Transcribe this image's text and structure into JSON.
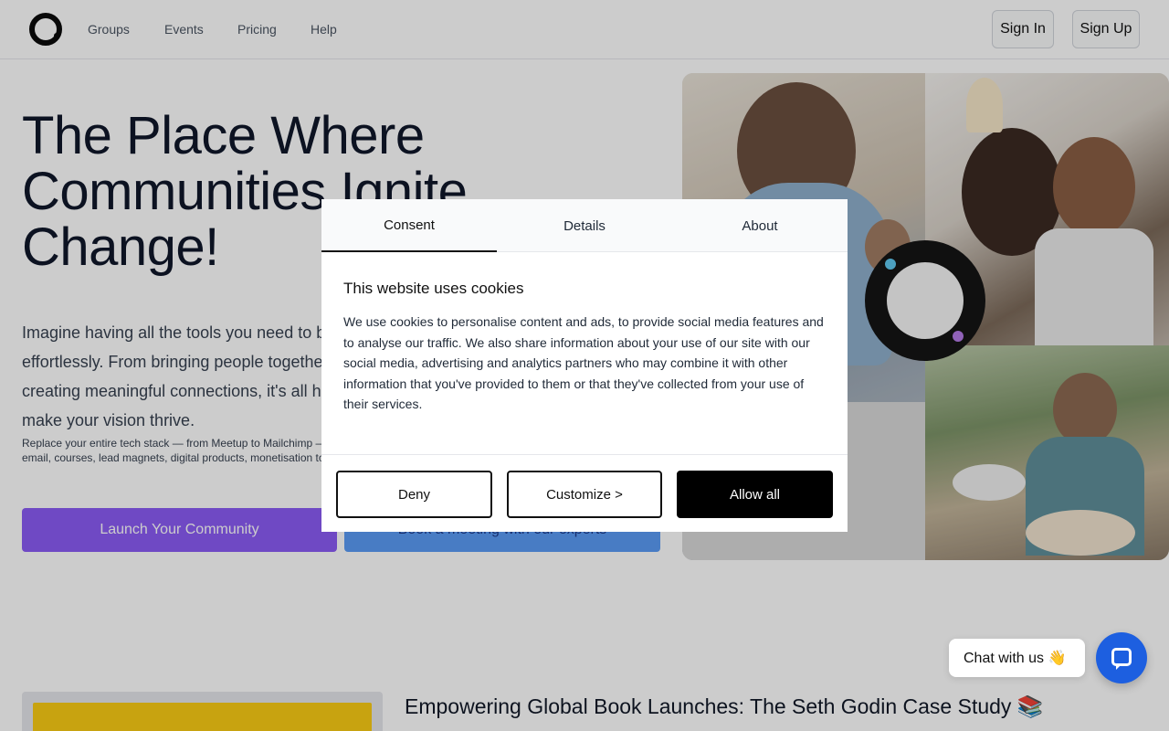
{
  "header": {
    "logo_icon": "ring-logo-icon",
    "nav": [
      "Groups",
      "Events",
      "Pricing",
      "Help"
    ],
    "sign_in": "Sign In",
    "sign_up": "Sign Up"
  },
  "hero": {
    "title_line1": "The Place Where",
    "title_line2": "Communities Ignite",
    "title_line3": "Change!",
    "desc_line1": "Imagine having all the tools you need to build and manage your community",
    "desc_line2": "effortlessly. From bringing people together to launching events and",
    "desc_line3": "creating meaningful connections, it's all here in one platform to help",
    "desc_line4": "make your vision thrive.",
    "small_line1": "Replace your entire tech stack — from Meetup to Mailchimp — with one platform for events,",
    "small_line2": "email, courses, lead magnets, digital products, monetisation tools and more.",
    "cta_primary": "Launch Your Community",
    "cta_secondary": "Book a meeting with our experts"
  },
  "case_study": {
    "title": "Empowering Global Book Launches: The Seth Godin Case Study 📚"
  },
  "cookie_dialog": {
    "tabs": [
      "Consent",
      "Details",
      "About"
    ],
    "active_tab": "Consent",
    "title": "This website uses cookies",
    "text": "We use cookies to personalise content and ads, to provide social media features and to analyse our traffic. We also share information about your use of our site with our social media, advertising and analytics partners who may combine it with other information that you've provided to them or that they've collected from your use of their services.",
    "deny": "Deny",
    "customize": "Customize >",
    "allow_all": "Allow all"
  },
  "chat": {
    "label": "Chat with us 👋",
    "icon": "chat-bubble-icon"
  },
  "colors": {
    "cta_primary": "#8b5cf6",
    "cta_secondary": "#5b9cf6",
    "chat_button": "#1d5fe0",
    "overlay": "rgba(0,0,0,0.2)"
  }
}
